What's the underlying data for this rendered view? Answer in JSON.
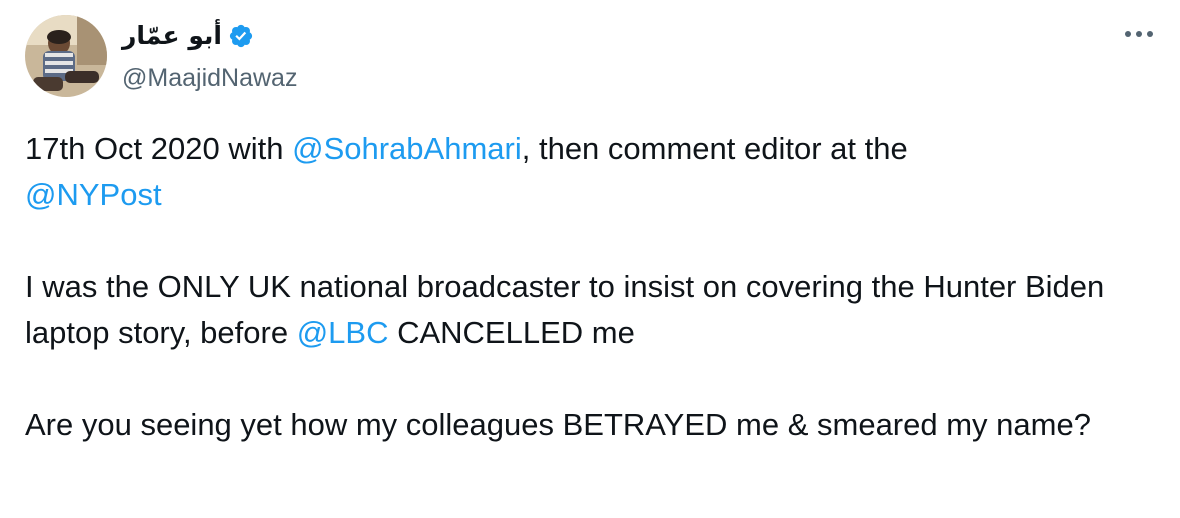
{
  "author": {
    "display_name": "أبو عمّار",
    "handle": "@MaajidNawaz",
    "verified": true
  },
  "icons": {
    "verified": "verified-badge-icon",
    "more": "more-options-icon"
  },
  "colors": {
    "text": "#0f1419",
    "secondary_text": "#536471",
    "link": "#1d9bf0",
    "verified_badge": "#1d9bf0",
    "background": "#ffffff"
  },
  "tweet": {
    "line1_prefix": "17th Oct 2020 with ",
    "mention_1": "@SohrabAhmari",
    "line1_suffix": ", then comment editor at the",
    "mention_2": "@NYPost",
    "para2_prefix": "I was the ONLY UK national broadcaster to insist on covering the Hunter Biden laptop story, before ",
    "mention_3": "@LBC",
    "para2_suffix": " CANCELLED me",
    "para3": "Are you seeing yet how my colleagues BETRAYED me & smeared my name?"
  }
}
